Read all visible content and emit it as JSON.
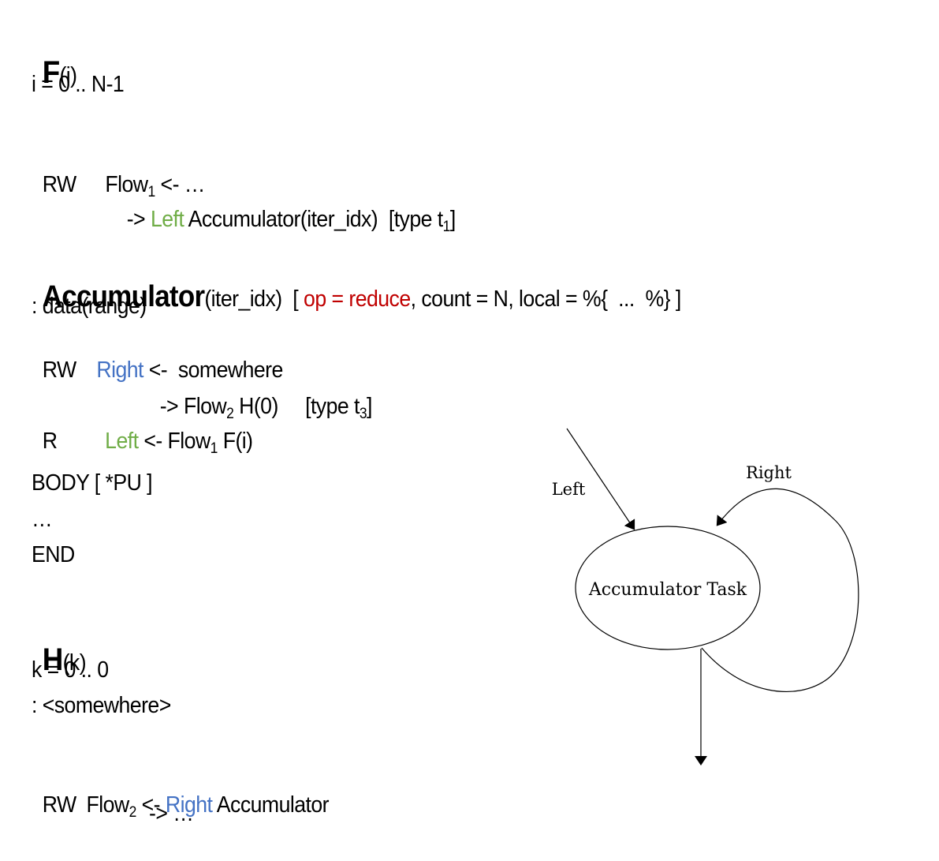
{
  "colors": {
    "green": "#70ad47",
    "blue": "#4472c4",
    "red": "#c00000",
    "text": "#000000"
  },
  "task_f": {
    "name": "F",
    "params": "(i)",
    "range": "i = 0 .. N-1",
    "flow_line": {
      "mode": "RW",
      "flow": "Flow",
      "flow_sub": "1",
      "arrow": " <- …"
    },
    "out_line": {
      "arrow": "-> ",
      "dep": "Left",
      "rest": " Accumulator(iter_idx)  [type t",
      "type_sub": "1",
      "close": "]"
    }
  },
  "task_acc": {
    "name": "Accumulator",
    "params": "(iter_idx)",
    "props_open": "  [ ",
    "op": "op = reduce",
    "props_rest": ", count = N, local = %{  ...  %} ]",
    "affinity": ": data(range)",
    "right_line": {
      "mode": "RW",
      "dep": "Right",
      "rest": " <-  somewhere"
    },
    "right_out": {
      "arrow": "-> Flow",
      "flow_sub": "2",
      "rest": " H(0)     [type t",
      "type_sub": "3",
      "close": "]"
    },
    "left_line": {
      "mode": "R",
      "dep": "Left",
      "rest": " <- Flow",
      "flow_sub": "1",
      "tail": " F(i)"
    },
    "body": "BODY [ *PU ]",
    "ellipsis": "…",
    "end": "END"
  },
  "task_h": {
    "name": "H",
    "params": "(k)",
    "range": "k = 0 .. 0",
    "affinity": ": <somewhere>",
    "flow_line": {
      "mode": "RW",
      "flow": "Flow",
      "flow_sub": "2",
      "arrow": " <- ",
      "dep": "Right",
      "rest": " Accumulator"
    },
    "out_line": "-> …"
  },
  "graph": {
    "node_label": "Accumulator Task",
    "edges": [
      {
        "label": "Left",
        "kind": "incoming"
      },
      {
        "label": "Right",
        "kind": "self-loop"
      },
      {
        "label": "",
        "kind": "outgoing"
      }
    ]
  }
}
